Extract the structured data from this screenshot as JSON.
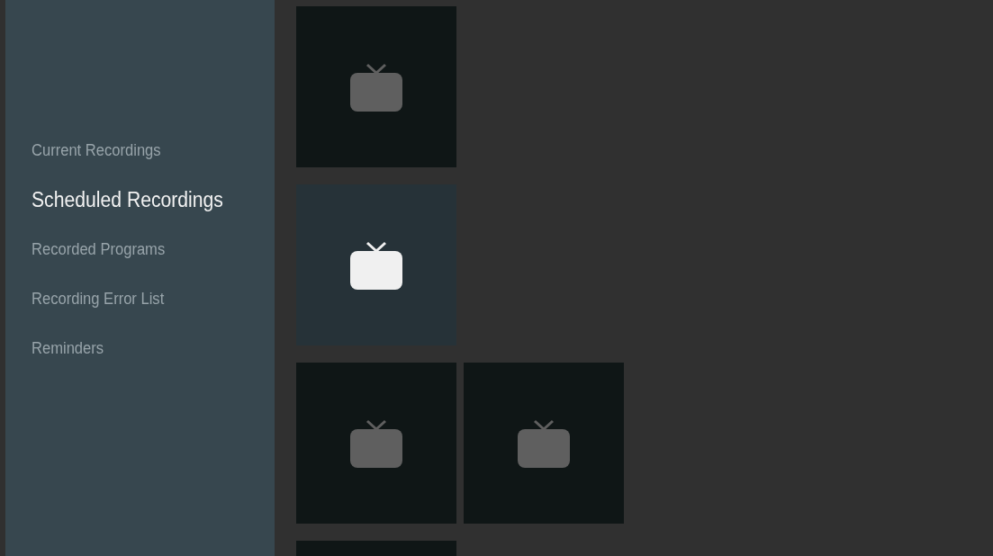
{
  "sidebar": {
    "items": [
      {
        "label": "Current Recordings",
        "selected": false
      },
      {
        "label": "Scheduled Recordings",
        "selected": true
      },
      {
        "label": "Recorded Programs",
        "selected": false
      },
      {
        "label": "Recording Error List",
        "selected": false
      },
      {
        "label": "Reminders",
        "selected": false
      }
    ]
  },
  "rows": [
    {
      "tiles": [
        {
          "selected": false
        }
      ]
    },
    {
      "tiles": [
        {
          "selected": true
        }
      ]
    },
    {
      "tiles": [
        {
          "selected": false
        },
        {
          "selected": false
        }
      ]
    },
    {
      "tiles": [
        {
          "selected": false
        }
      ]
    }
  ]
}
